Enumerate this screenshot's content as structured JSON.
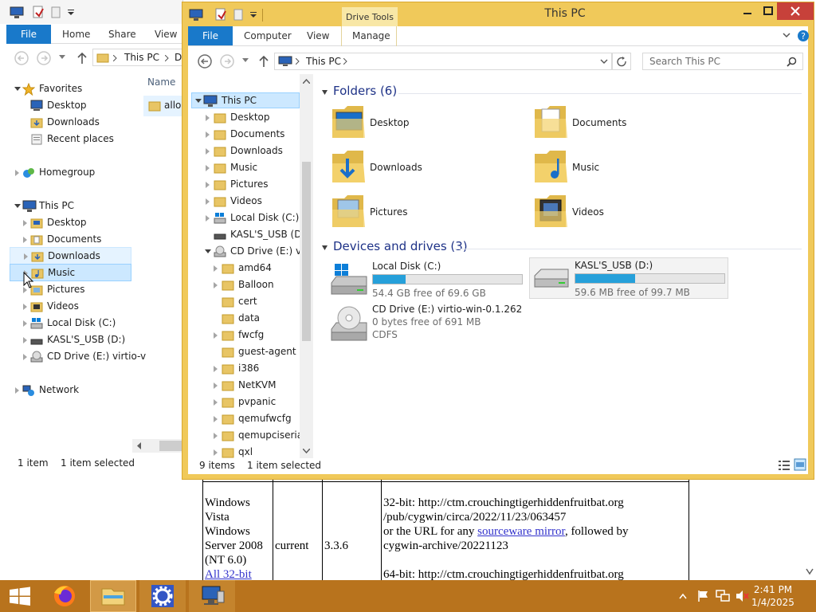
{
  "back_window": {
    "ribbon_tabs": {
      "file": "File",
      "home": "Home",
      "share": "Share",
      "view": "View"
    },
    "address": {
      "path": "This PC",
      "next": "D"
    },
    "column_header": "Name",
    "file_item": "allos",
    "tree": {
      "favorites": "Favorites",
      "desktop": "Desktop",
      "downloads": "Downloads",
      "recent": "Recent places",
      "homegroup": "Homegroup",
      "thispc": "This PC",
      "pc_desktop": "Desktop",
      "pc_documents": "Documents",
      "pc_downloads": "Downloads",
      "pc_music": "Music",
      "pc_pictures": "Pictures",
      "pc_videos": "Videos",
      "pc_local": "Local Disk (C:)",
      "pc_usb": "KASL'S_USB (D:)",
      "pc_cd": "CD Drive (E:) virtio-v",
      "network": "Network"
    },
    "status": {
      "count": "1 item",
      "selected": "1 item selected"
    }
  },
  "front_window": {
    "title": "This PC",
    "context_tab": "Drive Tools",
    "ribbon_tabs": {
      "file": "File",
      "computer": "Computer",
      "view": "View",
      "manage": "Manage"
    },
    "address": {
      "path": "This PC"
    },
    "search_placeholder": "Search This PC",
    "tree": {
      "thispc": "This PC",
      "desktop": "Desktop",
      "documents": "Documents",
      "downloads": "Downloads",
      "music": "Music",
      "pictures": "Pictures",
      "videos": "Videos",
      "local": "Local Disk (C:)",
      "usb": "KASL'S_USB (D:)",
      "cd": "CD Drive (E:) virti",
      "amd64": "amd64",
      "balloon": "Balloon",
      "cert": "cert",
      "data": "data",
      "fwcfg": "fwcfg",
      "guest_agent": "guest-agent",
      "i386": "i386",
      "netkvm": "NetKVM",
      "pvpanic": "pvpanic",
      "qemufwcfg": "qemufwcfg",
      "qemupciserial": "qemupciserial",
      "qxl": "qxl"
    },
    "folders_header": "Folders (6)",
    "folders": {
      "desktop": "Desktop",
      "documents": "Documents",
      "downloads": "Downloads",
      "music": "Music",
      "pictures": "Pictures",
      "videos": "Videos"
    },
    "drives_header": "Devices and drives (3)",
    "drives": {
      "c": {
        "name": "Local Disk (C:)",
        "free": "54.4 GB free of 69.6 GB",
        "used_fraction": 0.22
      },
      "d": {
        "name": "KASL'S_USB (D:)",
        "free": "59.6 MB free of 99.7 MB",
        "used_fraction": 0.4
      },
      "e": {
        "name": "CD Drive (E:) virtio-win-0.1.262",
        "free": "0 bytes free of 691 MB",
        "fs": "CDFS"
      }
    },
    "status": {
      "count": "9 items",
      "selected": "1 item selected"
    }
  },
  "web_page": {
    "os_line1": "Windows",
    "os_line2": "Vista",
    "os_line3": "Windows",
    "os_line4": "Server 2008",
    "os_line5": "(NT 6.0)",
    "os_link": "All 32-bit",
    "status": "current",
    "version": "3.3.6",
    "url_32a": "32-bit: http://ctm.crouchingtigerhiddenfruitbat.org",
    "url_32b": "/pub/cygwin/circa/2022/11/23/063457",
    "url_or": "or the URL for any",
    "url_link": "sourceware mirror",
    "url_followed": ", followed by",
    "url_archive": "cygwin-archive/20221123",
    "url_64a": "64-bit: http://ctm.crouchingtigerhiddenfruitbat.org"
  },
  "taskbar": {
    "time": "2:41 PM",
    "date": "1/4/2025"
  },
  "colors": {
    "accent": "#1979ca",
    "title_active": "#f0c95a",
    "taskbar": "#b8731d",
    "drive_bar": "#26a0da"
  }
}
